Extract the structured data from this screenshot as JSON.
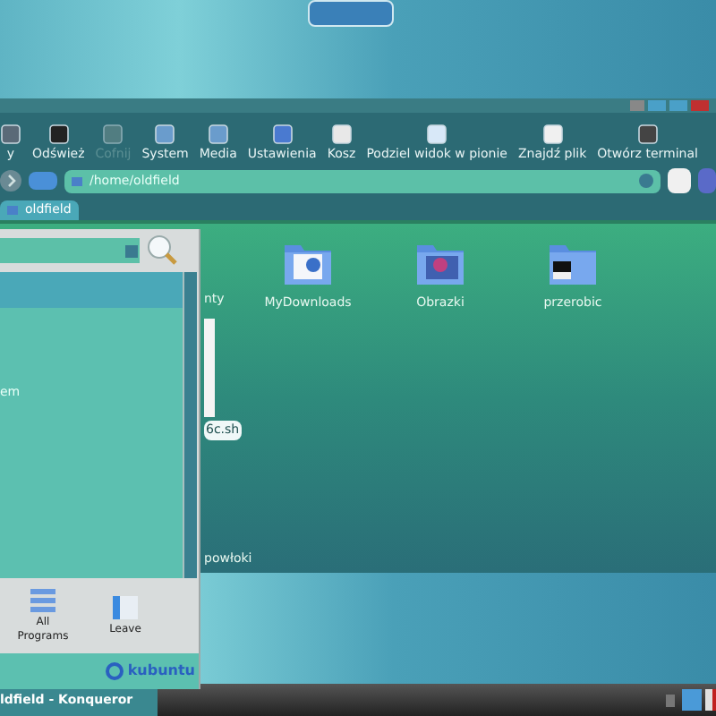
{
  "toolbar": [
    {
      "label": "y",
      "disabled": false
    },
    {
      "label": "Odśwież",
      "disabled": false
    },
    {
      "label": "Cofnij",
      "disabled": true
    },
    {
      "label": "System",
      "disabled": false
    },
    {
      "label": "Media",
      "disabled": false
    },
    {
      "label": "Ustawienia",
      "disabled": false
    },
    {
      "label": "Kosz",
      "disabled": false
    },
    {
      "label": "Podziel widok w pionie",
      "disabled": false
    },
    {
      "label": "Znajdź plik",
      "disabled": false
    },
    {
      "label": "Otwórz terminal",
      "disabled": false
    }
  ],
  "location": {
    "value": "/home/oldfield"
  },
  "tabs": [
    {
      "label": "oldfield",
      "selected": true
    }
  ],
  "partial_items": [
    {
      "name": "nty",
      "kind": "label"
    },
    {
      "name": "6c.sh",
      "kind": "script"
    },
    {
      "name": "powłoki",
      "kind": "label"
    }
  ],
  "files": [
    {
      "name": "MyDownloads",
      "kind": "web"
    },
    {
      "name": "Obrazki",
      "kind": "image"
    },
    {
      "name": "przerobic",
      "kind": "terminal"
    }
  ],
  "menu": {
    "item": "em",
    "buttons": [
      {
        "label": "All Programs",
        "kind": "programs"
      },
      {
        "label": "Leave",
        "kind": "leave"
      }
    ],
    "logo": "kubuntu"
  },
  "taskbar": {
    "task": "ldfield - Konqueror"
  }
}
